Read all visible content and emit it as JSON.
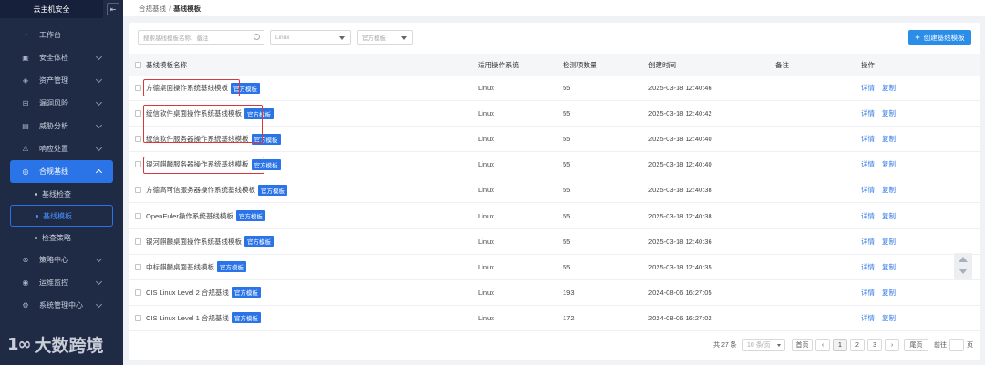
{
  "sidebar": {
    "app_title": "云主机安全",
    "collapse_icon": "collapse-icon",
    "items": [
      {
        "label": "工作台",
        "icon": "dashboard-icon"
      },
      {
        "label": "安全体检",
        "icon": "checkup-icon"
      },
      {
        "label": "资产管理",
        "icon": "asset-icon"
      },
      {
        "label": "漏洞风险",
        "icon": "vulnerability-icon"
      },
      {
        "label": "威胁分析",
        "icon": "threat-icon"
      },
      {
        "label": "响应处置",
        "icon": "response-icon"
      },
      {
        "label": "合规基线",
        "icon": "compliance-icon"
      },
      {
        "label": "策略中心",
        "icon": "policy-icon"
      },
      {
        "label": "运维监控",
        "icon": "monitor-icon"
      },
      {
        "label": "系统管理中心",
        "icon": "system-icon"
      }
    ],
    "sub_items": [
      "基线检查",
      "基线模板",
      "检查策略"
    ],
    "watermark": {
      "logo": "1∞",
      "text": "大数跨境"
    }
  },
  "header": {
    "crumb_parent": "合规基线",
    "separator": "/",
    "crumb_current": "基线模板"
  },
  "filters": {
    "search_placeholder": "搜索基线模板名称、备注",
    "os_select": "Linux",
    "type_select": "官方模板",
    "create_label": "创建基线模板"
  },
  "table": {
    "headers": {
      "name": "基线模板名称",
      "os": "适用操作系统",
      "count": "检测项数量",
      "time": "创建时间",
      "note": "备注",
      "ops": "操作"
    },
    "badge_label": "官方模板",
    "op_detail": "详情",
    "op_copy": "复制",
    "rows": [
      {
        "name": "方德桌面操作系统基线模板",
        "os": "Linux",
        "count": "55",
        "time": "2025-03-18 12:40:46"
      },
      {
        "name": "统信软件桌面操作系统基线模板",
        "os": "Linux",
        "count": "55",
        "time": "2025-03-18 12:40:42"
      },
      {
        "name": "统信软件服务器操作系统基线模板",
        "os": "Linux",
        "count": "55",
        "time": "2025-03-18 12:40:40"
      },
      {
        "name": "银河麒麟服务器操作系统基线模板",
        "os": "Linux",
        "count": "55",
        "time": "2025-03-18 12:40:40"
      },
      {
        "name": "方德高可信服务器操作系统基线模板",
        "os": "Linux",
        "count": "55",
        "time": "2025-03-18 12:40:38"
      },
      {
        "name": "OpenEuler操作系统基线模板",
        "os": "Linux",
        "count": "55",
        "time": "2025-03-18 12:40:38"
      },
      {
        "name": "银河麒麟桌面操作系统基线模板",
        "os": "Linux",
        "count": "55",
        "time": "2025-03-18 12:40:36"
      },
      {
        "name": "中标麒麟桌面基线模板",
        "os": "Linux",
        "count": "55",
        "time": "2025-03-18 12:40:35"
      },
      {
        "name": "CIS Linux Level 2 合规基线",
        "os": "Linux",
        "count": "193",
        "time": "2024-08-06 16:27:05"
      },
      {
        "name": "CIS Linux Level 1 合规基线",
        "os": "Linux",
        "count": "172",
        "time": "2024-08-06 16:27:02"
      }
    ]
  },
  "pagination": {
    "total": "共 27 条",
    "page_size": "10 条/页",
    "first": "首页",
    "prev": "‹",
    "pages": [
      "1",
      "2",
      "3"
    ],
    "next": "›",
    "last": "尾页",
    "goto_label": "前往",
    "goto_suffix": "页",
    "current_page": "1"
  },
  "colors": {
    "accent": "#2a74e8",
    "sidebar_bg": "#1f2a44",
    "highlight": "#d9383a"
  }
}
